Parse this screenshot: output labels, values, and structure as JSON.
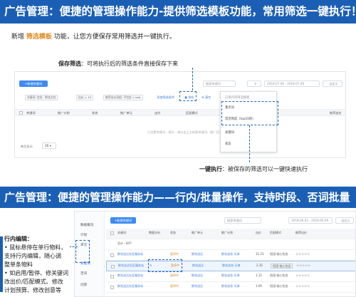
{
  "banner_top": "广告管理：便捷的管理操作能力-提供筛选模板功能，常用筛选一键执行！",
  "intro": {
    "prefix": "新增",
    "highlight": "筛选模板",
    "suffix": "功能，让您方便保存常用筛选并一键执行。"
  },
  "callout_save": {
    "title": "保存筛选",
    "text": "：可将执行后的筛选条件直接保存下来"
  },
  "callout_exec": {
    "title": "一键执行",
    "text": "：被保存的筛选可以一键快速执行"
  },
  "panel1": {
    "new_button": "+新建关键词",
    "search_placeholder": "搜索关键词",
    "date_range": "2018.07.06 - 2018.07.06",
    "custom_button": "自定义",
    "chips": [
      "关键词: 包含：鲜花五包",
      "出价 > 10",
      "推荐出价词组: 不包含 > test"
    ],
    "chip_links": [
      "添加筛选条件",
      "清空"
    ],
    "save_label": "保存",
    "columns": [
      "关键词",
      "推广计划",
      "状态",
      "推广单元",
      "出价",
      "匹配模式",
      "推荐出价"
    ],
    "empty_text": "已设置关键词，提示：请点击上方新建关键词，推广后出现数据",
    "page_size_label": "每页显示",
    "page_size": "20",
    "dropdown_items": [
      "已保存的筛选模板",
      "重点词",
      "常见筛选（top10的）",
      "关键词",
      "状态"
    ]
  },
  "banner_bottom": "广告管理：便捷的管理操作能力——行内/批量操作，支持时段、否词批量",
  "panel2": {
    "sidebar": [
      "数据概况",
      "计划",
      "单元",
      "关键词",
      "否词",
      "创意"
    ],
    "new_button": "+新建关键词",
    "search_placeholder": "搜索关键词",
    "date_range": "2018.06.03 - 2018.06.09",
    "custom_button": "自定义",
    "columns": [
      "关键词",
      "数据分析",
      "状态",
      "推广单元",
      "推广计划",
      "出价",
      "匹配模式",
      "推荐出价"
    ],
    "rows": [
      {
        "kw": "总计 - 847",
        "status": "",
        "unit": "",
        "plan": "",
        "bid": "",
        "match": "",
        "stars": ""
      },
      {
        "kw": "鲜花送达社区服务站",
        "status": "暂停中",
        "unit": "鲜花送达",
        "plan": "鲜花送花-天津",
        "bid": "11.23",
        "match": "短语-核心包含",
        "stars": "☆☆☆☆☆"
      },
      {
        "kw": "鲜花送达社区服务站",
        "status": "暂停中",
        "unit": "鲜花送达",
        "plan": "鲜花送花-天津",
        "bid": "2.35",
        "match": "短语-核心包含",
        "stars": "☆☆☆☆☆"
      },
      {
        "kw": "鲜花送达社区服务站",
        "status": "暂停中",
        "unit": "鲜花送达",
        "plan": "鲜花送花-天津",
        "bid": "1.12",
        "match": "短语-核心包含",
        "stars": "☆☆☆☆☆"
      },
      {
        "kw": "鲜花送达社区服务站",
        "status": "暂停中",
        "unit": "鲜花送达",
        "plan": "鲜花送花-天津",
        "bid": "1.00",
        "match": "短语-核心包含",
        "stars": "☆☆☆☆☆"
      }
    ]
  },
  "inline_note": {
    "title": "行内编辑：",
    "lines": [
      "• 鼠标悬停在单行物料，",
      "支持行内编辑，随心调",
      "整单条物料",
      "• 如启用/暂停、修关键词",
      "改出价/匹配模式、修改",
      "计划预算、修改创意等"
    ]
  },
  "colors": {
    "banner": "#1b5fb5",
    "accent": "#e08a1e",
    "primary_button": "#3d8bf0",
    "dash": "#1d63b8"
  }
}
